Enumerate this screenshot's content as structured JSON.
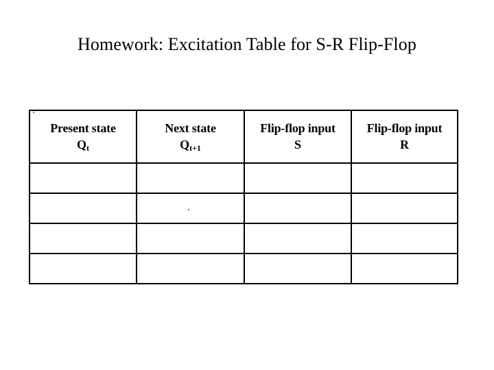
{
  "slide": {
    "title": "Homework:  Excitation Table for S-R Flip-Flop",
    "background_color": "#ffffff",
    "text_color": "#000000"
  },
  "table": {
    "border_color": "#000000",
    "columns": [
      {
        "line1": "Present state",
        "symbol": "Q",
        "subscript": "t"
      },
      {
        "line1": "Next state",
        "symbol": "Q",
        "subscript": "t+1"
      },
      {
        "line1": "Flip-flop input",
        "symbol": "S",
        "subscript": ""
      },
      {
        "line1": "Flip-flop input",
        "symbol": "R",
        "subscript": ""
      }
    ],
    "rows": [
      {
        "cells": [
          "",
          "",
          "",
          ""
        ]
      },
      {
        "cells": [
          "",
          "",
          "",
          ""
        ]
      },
      {
        "cells": [
          "",
          "",
          "",
          ""
        ]
      },
      {
        "cells": [
          "",
          "",
          "",
          ""
        ]
      }
    ]
  }
}
